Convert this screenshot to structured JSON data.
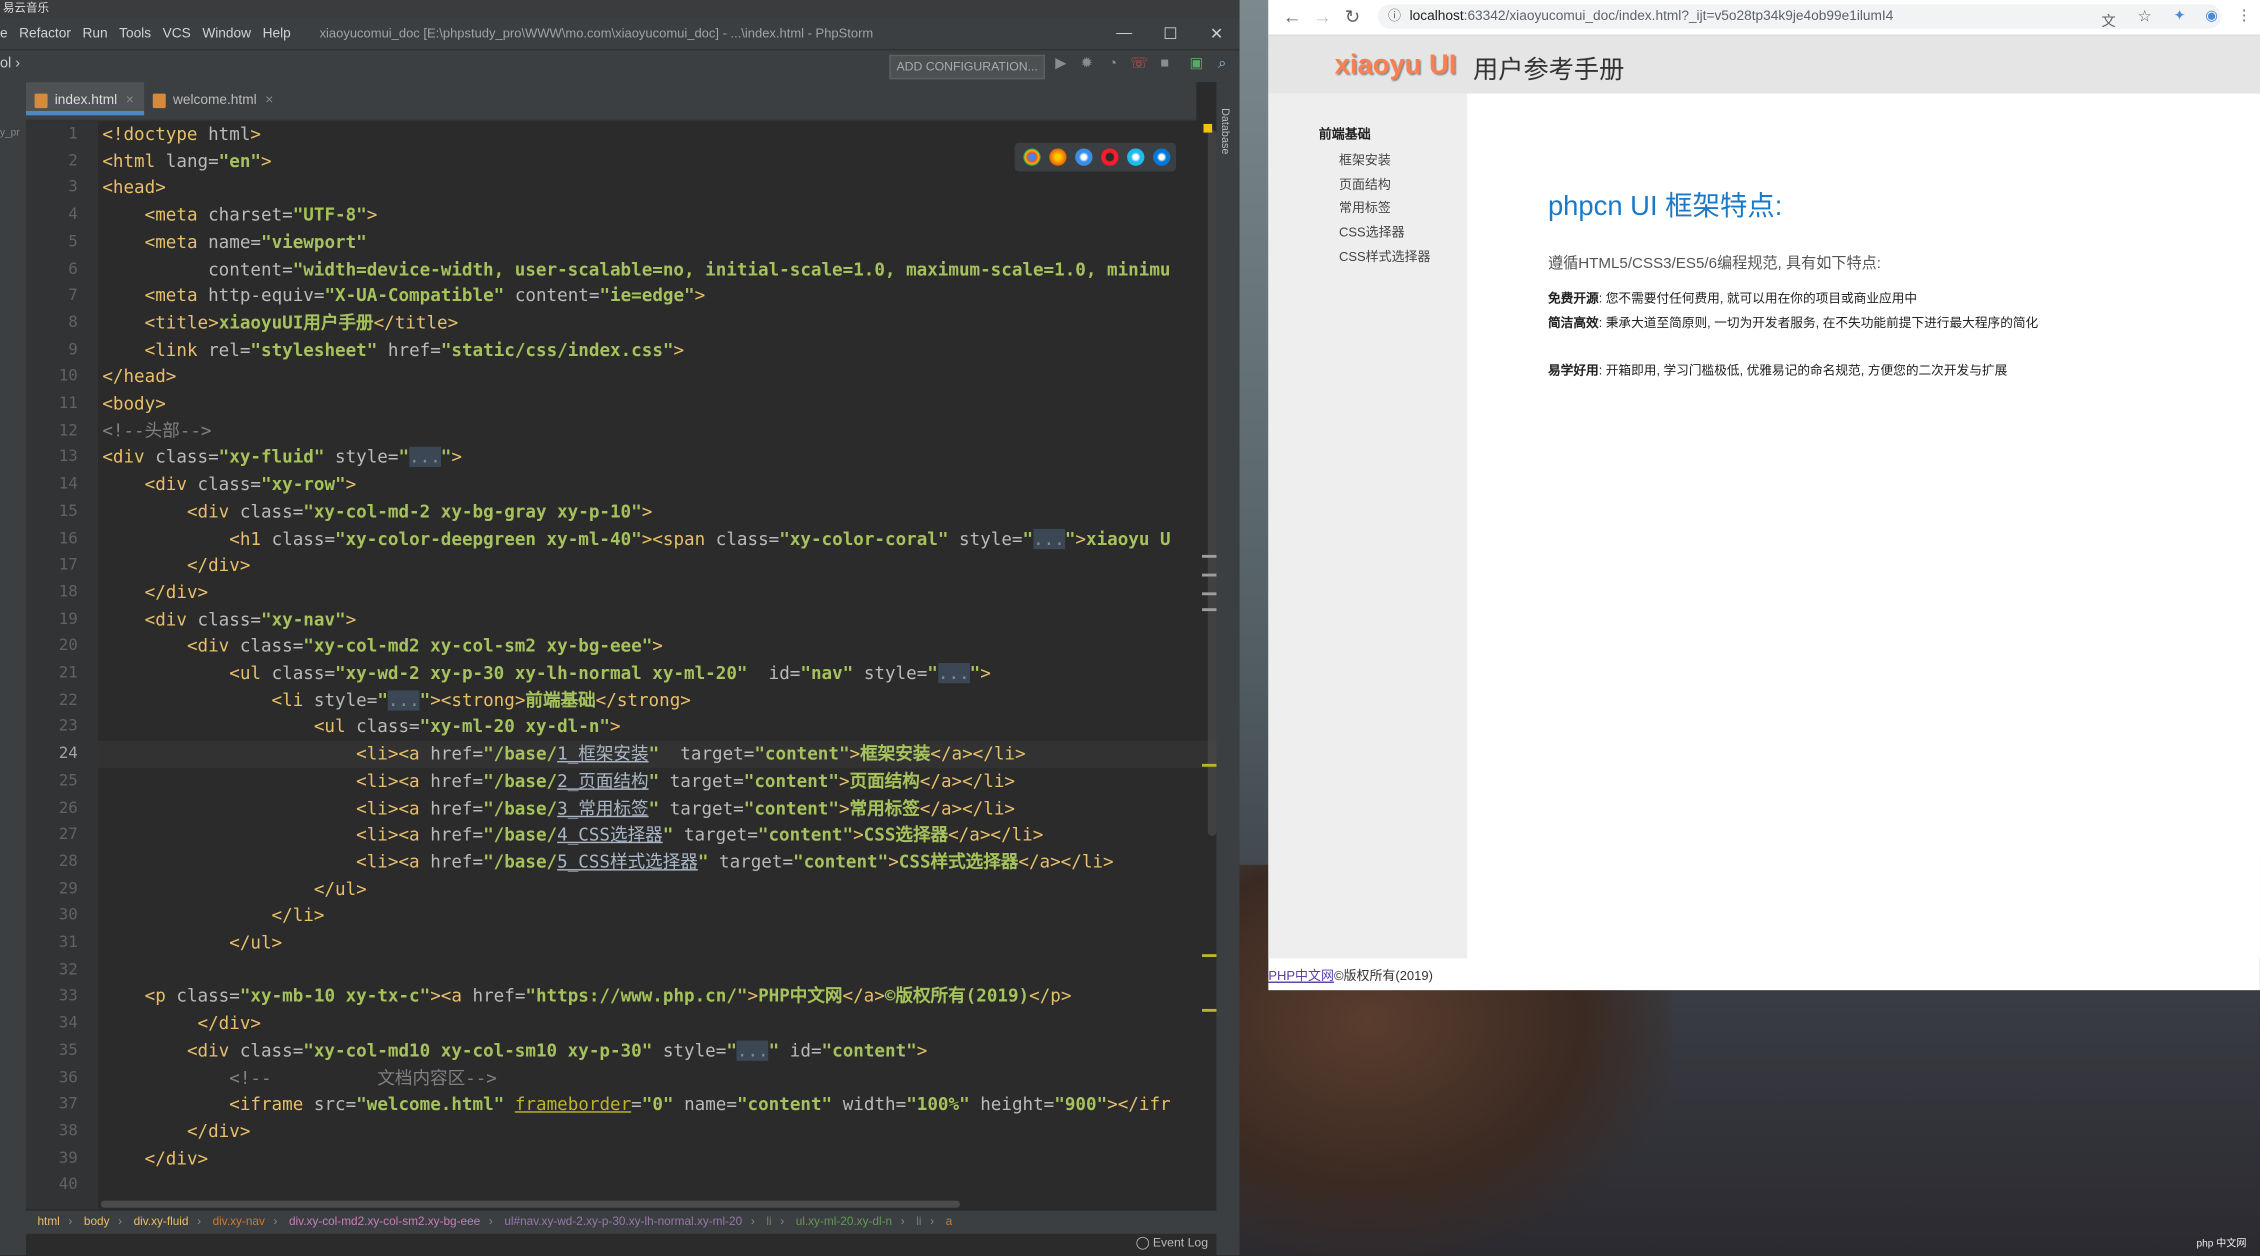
{
  "ide": {
    "netease_title": "易云音乐",
    "menu": [
      "e",
      "Refactor",
      "Run",
      "Tools",
      "VCS",
      "Window",
      "Help"
    ],
    "window_title": "xiaoyucomui_doc [E:\\phpstudy_pro\\WWW\\mo.com\\xiaoyucomui_doc] - ...\\index.html - PhpStorm",
    "window_controls": {
      "minimize": "—",
      "maximize": "☐",
      "close": "✕"
    },
    "nav_crumb": "ol ›",
    "add_config": "ADD CONFIGURATION...",
    "tabs": [
      {
        "label": "index.html",
        "close": "×"
      },
      {
        "label": "welcome.html",
        "close": "×"
      }
    ],
    "project_label": "y_pr",
    "right_panel": "Database",
    "current_line": 24,
    "line_numbers": [
      "1",
      "2",
      "3",
      "4",
      "5",
      "6",
      "7",
      "8",
      "9",
      "10",
      "11",
      "12",
      "13",
      "14",
      "15",
      "16",
      "17",
      "18",
      "19",
      "20",
      "21",
      "22",
      "23",
      "24",
      "25",
      "26",
      "27",
      "28",
      "29",
      "30",
      "31",
      "32",
      "33",
      "34",
      "35",
      "36",
      "37",
      "38",
      "39",
      "40"
    ],
    "code": [
      [
        {
          "c": "t",
          "x": "<!doctype "
        },
        {
          "c": "a",
          "x": "html"
        },
        {
          "c": "t",
          "x": ">"
        }
      ],
      [
        {
          "c": "t",
          "x": "<html "
        },
        {
          "c": "a",
          "x": "lang="
        },
        {
          "c": "v",
          "x": "\"en\""
        },
        {
          "c": "t",
          "x": ">"
        }
      ],
      [
        {
          "c": "t",
          "x": "<head>"
        }
      ],
      [
        {
          "c": "",
          "x": "    "
        },
        {
          "c": "t",
          "x": "<meta "
        },
        {
          "c": "a",
          "x": "charset="
        },
        {
          "c": "v",
          "x": "\"UTF-8\""
        },
        {
          "c": "t",
          "x": ">"
        }
      ],
      [
        {
          "c": "",
          "x": "    "
        },
        {
          "c": "t",
          "x": "<meta "
        },
        {
          "c": "a",
          "x": "name="
        },
        {
          "c": "v",
          "x": "\"viewport\""
        }
      ],
      [
        {
          "c": "",
          "x": "          "
        },
        {
          "c": "a",
          "x": "content="
        },
        {
          "c": "v",
          "x": "\"width=device-width, user-scalable=no, initial-scale=1.0, maximum-scale=1.0, minimu"
        }
      ],
      [
        {
          "c": "",
          "x": "    "
        },
        {
          "c": "t",
          "x": "<meta "
        },
        {
          "c": "a",
          "x": "http-equiv="
        },
        {
          "c": "v",
          "x": "\"X-UA-Compatible\""
        },
        {
          "c": "a",
          "x": " content="
        },
        {
          "c": "v",
          "x": "\"ie=edge\""
        },
        {
          "c": "t",
          "x": ">"
        }
      ],
      [
        {
          "c": "",
          "x": "    "
        },
        {
          "c": "t",
          "x": "<title>"
        },
        {
          "c": "v",
          "x": "xiaoyuUI用户手册"
        },
        {
          "c": "t",
          "x": "</title>"
        }
      ],
      [
        {
          "c": "",
          "x": "    "
        },
        {
          "c": "t",
          "x": "<link "
        },
        {
          "c": "a",
          "x": "rel="
        },
        {
          "c": "v",
          "x": "\"stylesheet\""
        },
        {
          "c": "a",
          "x": " href="
        },
        {
          "c": "v",
          "x": "\"static/css/index.css\""
        },
        {
          "c": "t",
          "x": ">"
        }
      ],
      [
        {
          "c": "t",
          "x": "</head>"
        }
      ],
      [
        {
          "c": "t",
          "x": "<body>"
        }
      ],
      [
        {
          "c": "cm",
          "x": "<!--头部-->"
        }
      ],
      [
        {
          "c": "t",
          "x": "<div "
        },
        {
          "c": "a",
          "x": "class="
        },
        {
          "c": "v",
          "x": "\"xy-fluid\""
        },
        {
          "c": "a",
          "x": " style="
        },
        {
          "c": "v",
          "x": "\""
        },
        {
          "c": "fold",
          "x": "..."
        },
        {
          "c": "v",
          "x": "\""
        },
        {
          "c": "t",
          "x": ">"
        }
      ],
      [
        {
          "c": "",
          "x": "    "
        },
        {
          "c": "t",
          "x": "<div "
        },
        {
          "c": "a",
          "x": "class="
        },
        {
          "c": "v",
          "x": "\"xy-row\""
        },
        {
          "c": "t",
          "x": ">"
        }
      ],
      [
        {
          "c": "",
          "x": "        "
        },
        {
          "c": "t",
          "x": "<div "
        },
        {
          "c": "a",
          "x": "class="
        },
        {
          "c": "v",
          "x": "\"xy-col-md-2 xy-bg-gray xy-p-10\""
        },
        {
          "c": "t",
          "x": ">"
        }
      ],
      [
        {
          "c": "",
          "x": "            "
        },
        {
          "c": "t",
          "x": "<h1 "
        },
        {
          "c": "a",
          "x": "class="
        },
        {
          "c": "v",
          "x": "\"xy-color-deepgreen xy-ml-40\""
        },
        {
          "c": "t",
          "x": "><span "
        },
        {
          "c": "a",
          "x": "class="
        },
        {
          "c": "v",
          "x": "\"xy-color-coral\""
        },
        {
          "c": "a",
          "x": " style="
        },
        {
          "c": "v",
          "x": "\""
        },
        {
          "c": "fold",
          "x": "..."
        },
        {
          "c": "v",
          "x": "\""
        },
        {
          "c": "t",
          "x": ">"
        },
        {
          "c": "v",
          "x": "xiaoyu U"
        }
      ],
      [
        {
          "c": "",
          "x": "        "
        },
        {
          "c": "t",
          "x": "</div>"
        }
      ],
      [
        {
          "c": "",
          "x": "    "
        },
        {
          "c": "t",
          "x": "</div>"
        }
      ],
      [
        {
          "c": "",
          "x": "    "
        },
        {
          "c": "t",
          "x": "<div "
        },
        {
          "c": "a",
          "x": "class="
        },
        {
          "c": "v",
          "x": "\"xy-nav\""
        },
        {
          "c": "t",
          "x": ">"
        }
      ],
      [
        {
          "c": "",
          "x": "        "
        },
        {
          "c": "t",
          "x": "<div "
        },
        {
          "c": "a",
          "x": "class="
        },
        {
          "c": "v",
          "x": "\"xy-col-md2 xy-col-sm2 xy-bg-eee\""
        },
        {
          "c": "t",
          "x": ">"
        }
      ],
      [
        {
          "c": "",
          "x": "            "
        },
        {
          "c": "t",
          "x": "<ul "
        },
        {
          "c": "a",
          "x": "class="
        },
        {
          "c": "v",
          "x": "\"xy-wd-2 xy-p-30 xy-lh-normal xy-ml-20\""
        },
        {
          "c": "a",
          "x": "  id="
        },
        {
          "c": "v",
          "x": "\"nav\""
        },
        {
          "c": "a",
          "x": " style="
        },
        {
          "c": "v",
          "x": "\""
        },
        {
          "c": "fold",
          "x": "..."
        },
        {
          "c": "v",
          "x": "\""
        },
        {
          "c": "t",
          "x": ">"
        }
      ],
      [
        {
          "c": "",
          "x": "                "
        },
        {
          "c": "t",
          "x": "<li "
        },
        {
          "c": "a",
          "x": "style="
        },
        {
          "c": "v",
          "x": "\""
        },
        {
          "c": "fold",
          "x": "..."
        },
        {
          "c": "v",
          "x": "\""
        },
        {
          "c": "t",
          "x": "><strong>"
        },
        {
          "c": "v",
          "x": "前端基础"
        },
        {
          "c": "t",
          "x": "</strong>"
        }
      ],
      [
        {
          "c": "",
          "x": "                    "
        },
        {
          "c": "t",
          "x": "<ul "
        },
        {
          "c": "a",
          "x": "class="
        },
        {
          "c": "v",
          "x": "\"xy-ml-20 xy-dl-n\""
        },
        {
          "c": "t",
          "x": ">"
        }
      ],
      [
        {
          "c": "",
          "x": "                        "
        },
        {
          "c": "t",
          "x": "<li><a "
        },
        {
          "c": "a",
          "x": "href="
        },
        {
          "c": "v",
          "x": "\"/base/"
        },
        {
          "c": "lnk",
          "x": "1_框架安装"
        },
        {
          "c": "v",
          "x": "\""
        },
        {
          "c": "a",
          "x": "  target="
        },
        {
          "c": "v",
          "x": "\"content\""
        },
        {
          "c": "t",
          "x": ">"
        },
        {
          "c": "v",
          "x": "框架安装"
        },
        {
          "c": "t",
          "x": "</a></li>"
        }
      ],
      [
        {
          "c": "",
          "x": "                        "
        },
        {
          "c": "t",
          "x": "<li><a "
        },
        {
          "c": "a",
          "x": "href="
        },
        {
          "c": "v",
          "x": "\"/base/"
        },
        {
          "c": "lnk",
          "x": "2_页面结构"
        },
        {
          "c": "v",
          "x": "\""
        },
        {
          "c": "a",
          "x": " target="
        },
        {
          "c": "v",
          "x": "\"content\""
        },
        {
          "c": "t",
          "x": ">"
        },
        {
          "c": "v",
          "x": "页面结构"
        },
        {
          "c": "t",
          "x": "</a></li>"
        }
      ],
      [
        {
          "c": "",
          "x": "                        "
        },
        {
          "c": "t",
          "x": "<li><a "
        },
        {
          "c": "a",
          "x": "href="
        },
        {
          "c": "v",
          "x": "\"/base/"
        },
        {
          "c": "lnk",
          "x": "3_常用标签"
        },
        {
          "c": "v",
          "x": "\""
        },
        {
          "c": "a",
          "x": " target="
        },
        {
          "c": "v",
          "x": "\"content\""
        },
        {
          "c": "t",
          "x": ">"
        },
        {
          "c": "v",
          "x": "常用标签"
        },
        {
          "c": "t",
          "x": "</a></li>"
        }
      ],
      [
        {
          "c": "",
          "x": "                        "
        },
        {
          "c": "t",
          "x": "<li><a "
        },
        {
          "c": "a",
          "x": "href="
        },
        {
          "c": "v",
          "x": "\"/base/"
        },
        {
          "c": "lnk",
          "x": "4_CSS选择器"
        },
        {
          "c": "v",
          "x": "\""
        },
        {
          "c": "a",
          "x": " target="
        },
        {
          "c": "v",
          "x": "\"content\""
        },
        {
          "c": "t",
          "x": ">"
        },
        {
          "c": "v",
          "x": "CSS选择器"
        },
        {
          "c": "t",
          "x": "</a></li>"
        }
      ],
      [
        {
          "c": "",
          "x": "                        "
        },
        {
          "c": "t",
          "x": "<li><a "
        },
        {
          "c": "a",
          "x": "href="
        },
        {
          "c": "v",
          "x": "\"/base/"
        },
        {
          "c": "lnk",
          "x": "5_CSS样式选择器"
        },
        {
          "c": "v",
          "x": "\""
        },
        {
          "c": "a",
          "x": " target="
        },
        {
          "c": "v",
          "x": "\"content\""
        },
        {
          "c": "t",
          "x": ">"
        },
        {
          "c": "v",
          "x": "CSS样式选择器"
        },
        {
          "c": "t",
          "x": "</a></li>"
        }
      ],
      [
        {
          "c": "",
          "x": "                    "
        },
        {
          "c": "t",
          "x": "</ul>"
        }
      ],
      [
        {
          "c": "",
          "x": "                "
        },
        {
          "c": "t",
          "x": "</li>"
        }
      ],
      [
        {
          "c": "",
          "x": "            "
        },
        {
          "c": "t",
          "x": "</ul>"
        }
      ],
      [
        {
          "c": "",
          "x": ""
        }
      ],
      [
        {
          "c": "",
          "x": "    "
        },
        {
          "c": "t",
          "x": "<p "
        },
        {
          "c": "a",
          "x": "class="
        },
        {
          "c": "v",
          "x": "\"xy-mb-10 xy-tx-c\""
        },
        {
          "c": "t",
          "x": "><a "
        },
        {
          "c": "a",
          "x": "href="
        },
        {
          "c": "v",
          "x": "\"https://www.php.cn/\""
        },
        {
          "c": "t",
          "x": ">"
        },
        {
          "c": "v",
          "x": "PHP中文网"
        },
        {
          "c": "t",
          "x": "</a>"
        },
        {
          "c": "v",
          "x": "©版权所有(2019)"
        },
        {
          "c": "t",
          "x": "</p>"
        }
      ],
      [
        {
          "c": "",
          "x": "         "
        },
        {
          "c": "t",
          "x": "</div>"
        }
      ],
      [
        {
          "c": "",
          "x": "        "
        },
        {
          "c": "t",
          "x": "<div "
        },
        {
          "c": "a",
          "x": "class="
        },
        {
          "c": "v",
          "x": "\"xy-col-md10 xy-col-sm10 xy-p-30\""
        },
        {
          "c": "a",
          "x": " style="
        },
        {
          "c": "v",
          "x": "\""
        },
        {
          "c": "fold",
          "x": "..."
        },
        {
          "c": "v",
          "x": "\""
        },
        {
          "c": "a",
          "x": " id="
        },
        {
          "c": "v",
          "x": "\"content\""
        },
        {
          "c": "t",
          "x": ">"
        }
      ],
      [
        {
          "c": "",
          "x": "            "
        },
        {
          "c": "cm",
          "x": "<!--          文档内容区-->"
        }
      ],
      [
        {
          "c": "",
          "x": "            "
        },
        {
          "c": "t",
          "x": "<iframe "
        },
        {
          "c": "a",
          "x": "src="
        },
        {
          "c": "v",
          "x": "\"welcome.html\""
        },
        {
          "c": "",
          "x": " "
        },
        {
          "c": "warn",
          "x": "frameborder"
        },
        {
          "c": "a",
          "x": "="
        },
        {
          "c": "v",
          "x": "\"0\""
        },
        {
          "c": "a",
          "x": " name="
        },
        {
          "c": "v",
          "x": "\"content\""
        },
        {
          "c": "a",
          "x": " width="
        },
        {
          "c": "v",
          "x": "\"100%\""
        },
        {
          "c": "a",
          "x": " height="
        },
        {
          "c": "v",
          "x": "\"900\""
        },
        {
          "c": "t",
          "x": "></ifr"
        }
      ],
      [
        {
          "c": "",
          "x": "        "
        },
        {
          "c": "t",
          "x": "</div>"
        }
      ],
      [
        {
          "c": "",
          "x": "    "
        },
        {
          "c": "t",
          "x": "</div>"
        }
      ],
      [
        {
          "c": "",
          "x": ""
        }
      ]
    ],
    "breadcrumbs": [
      {
        "label": "html",
        "color": "#e8bf6a"
      },
      {
        "label": "body",
        "color": "#e8bf6a"
      },
      {
        "label": "div.xy-fluid",
        "color": "#e8bf6a"
      },
      {
        "label": "div.xy-nav",
        "color": "#cc7832"
      },
      {
        "label": "div.xy-col-md2.xy-col-sm2.xy-bg-eee",
        "color": "#c77dbb"
      },
      {
        "label": "ul#nav.xy-wd-2.xy-p-30.xy-lh-normal.xy-ml-20",
        "color": "#9876aa"
      },
      {
        "label": "li",
        "color": "#6a8759"
      },
      {
        "label": "ul.xy-ml-20.xy-dl-n",
        "color": "#629755"
      },
      {
        "label": "li",
        "color": "#6a8759"
      },
      {
        "label": "a",
        "color": "#cc7832"
      }
    ],
    "event_log": "Event Log"
  },
  "browser": {
    "url_host": "localhost",
    "url_rest": ":63342/xiaoyucomui_doc/index.html?_ijt=v5o28tp34k9je4ob99e1ilumI4",
    "brand": "xiaoyu UI",
    "subtitle": "用户参考手册",
    "nav": {
      "category": "前端基础",
      "items": [
        "框架安装",
        "页面结构",
        "常用标签",
        "CSS选择器",
        "CSS样式选择器"
      ]
    },
    "content": {
      "heading": "phpcn UI 框架特点:",
      "lead": "遵循HTML5/CSS3/ES5/6编程规范, 具有如下特点:",
      "features": [
        {
          "title": "免费开源",
          "text": ": 您不需要付任何费用, 就可以用在你的项目或商业应用中"
        },
        {
          "title": "简洁高效",
          "text": ": 秉承大道至简原则, 一切为开发者服务, 在不失功能前提下进行最大程序的简化"
        },
        {
          "title": "易学好用",
          "text": ": 开箱即用, 学习门槛极低, 优雅易记的命名规范, 方便您的二次开发与扩展"
        }
      ]
    },
    "footer": {
      "link": "PHP中文网",
      "text": "©版权所有(2019)"
    }
  },
  "watermark": "php 中文网"
}
